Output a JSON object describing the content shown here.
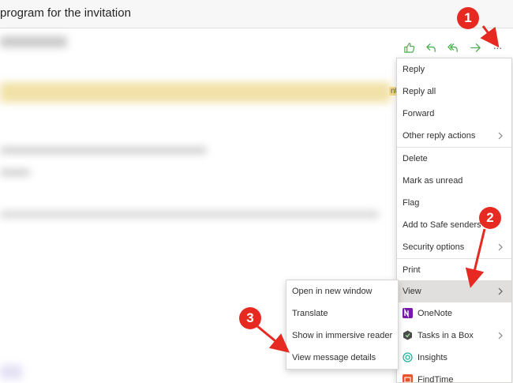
{
  "subject": {
    "title": "program for the invitation"
  },
  "toolbar": {
    "like_icon": "thumbs-up-icon",
    "reply_icon": "reply-icon",
    "reply_all_icon": "reply-all-icon",
    "forward_icon": "forward-icon",
    "more_label": "···",
    "accent": "#4caf50"
  },
  "banner_fragment": "nt",
  "menu": {
    "reply": "Reply",
    "reply_all": "Reply all",
    "forward": "Forward",
    "other_reply_actions": "Other reply actions",
    "delete": "Delete",
    "mark_unread": "Mark as unread",
    "flag": "Flag",
    "add_safe_senders": "Add to Safe senders",
    "security_options": "Security options",
    "print": "Print",
    "view": "View",
    "onenote": "OneNote",
    "tasks_in_a_box": "Tasks in a Box",
    "insights": "Insights",
    "findtime": "FindTime"
  },
  "submenu": {
    "open_new_window": "Open in new window",
    "translate": "Translate",
    "immersive_reader": "Show in immersive reader",
    "view_message_details": "View message details"
  },
  "annotations": {
    "step1": "1",
    "step2": "2",
    "step3": "3",
    "color": "#e62a22"
  }
}
